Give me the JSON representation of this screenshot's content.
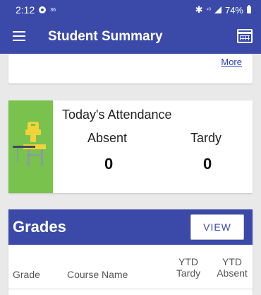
{
  "status_bar": {
    "time": "2:12",
    "tiny_label": "36",
    "network_text": "⁴ᴳ",
    "battery": "74%"
  },
  "app_bar": {
    "title": "Student Summary",
    "menu_icon": "hamburger-menu-icon",
    "calendar_icon": "calendar-icon"
  },
  "top_card": {
    "more_link": "More"
  },
  "attendance": {
    "title": "Today's Attendance",
    "absent_label": "Absent",
    "absent_value": "0",
    "tardy_label": "Tardy",
    "tardy_value": "0",
    "icon": "school-desk-icon",
    "accent_color": "#78c24d"
  },
  "grades": {
    "title": "Grades",
    "view_button": "VIEW",
    "columns": [
      "Grade",
      "Course Name",
      "YTD Tardy",
      "YTD Absent"
    ]
  },
  "colors": {
    "primary": "#3b4aa8",
    "link": "#2a3bbd",
    "background": "#e9e9e9"
  }
}
